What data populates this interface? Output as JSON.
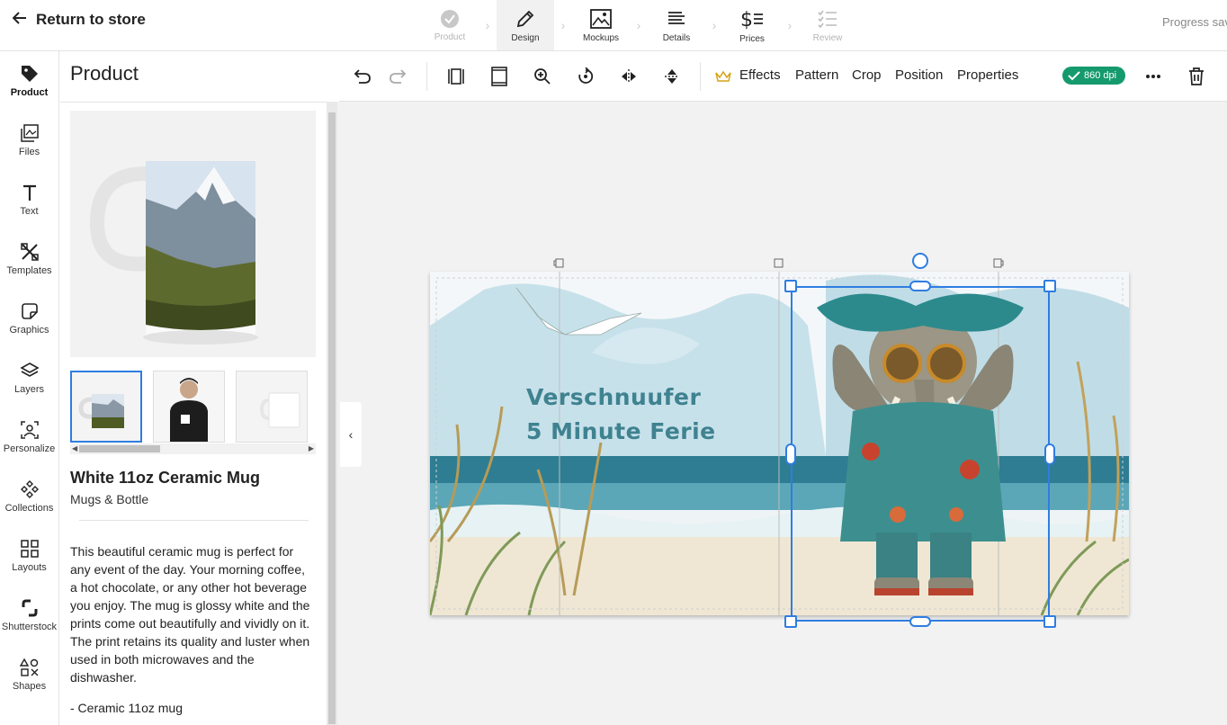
{
  "header": {
    "back_label": "Return to store",
    "steps": [
      {
        "label": "Product",
        "icon": "check-circle-icon",
        "state": "done"
      },
      {
        "label": "Design",
        "icon": "pencil-icon",
        "state": "active"
      },
      {
        "label": "Mockups",
        "icon": "image-icon",
        "state": "normal"
      },
      {
        "label": "Details",
        "icon": "text-lines-icon",
        "state": "normal"
      },
      {
        "label": "Prices",
        "icon": "dollar-icon",
        "state": "normal"
      },
      {
        "label": "Review",
        "icon": "checklist-icon",
        "state": "disabled"
      }
    ],
    "progress_text": "Progress saved"
  },
  "leftnav": {
    "items": [
      {
        "label": "Product",
        "icon": "tag-icon",
        "active": true
      },
      {
        "label": "Files",
        "icon": "files-icon"
      },
      {
        "label": "Text",
        "icon": "text-icon"
      },
      {
        "label": "Templates",
        "icon": "templates-icon"
      },
      {
        "label": "Graphics",
        "icon": "graphics-icon"
      },
      {
        "label": "Layers",
        "icon": "layers-icon"
      },
      {
        "label": "Personalize",
        "icon": "personalize-icon"
      },
      {
        "label": "Collections",
        "icon": "collections-icon"
      },
      {
        "label": "Layouts",
        "icon": "layouts-icon"
      },
      {
        "label": "Shutterstock",
        "icon": "shutterstock-icon"
      },
      {
        "label": "Shapes",
        "icon": "shapes-icon"
      }
    ]
  },
  "panel": {
    "title": "Product",
    "product_name": "White 11oz Ceramic Mug",
    "category": "Mugs & Bottle",
    "description": "This beautiful ceramic mug is perfect for any event of the day. Your morning coffee, a hot chocolate, or any other hot beverage you enjoy. The mug is glossy white and the prints come out beautifully and vividly on it. The print retains its quality and luster when used in both microwaves and the dishwasher.",
    "bullet": "- Ceramic 11oz mug"
  },
  "toolbar": {
    "effects": "Effects",
    "pattern": "Pattern",
    "crop": "Crop",
    "position": "Position",
    "properties": "Properties",
    "dpi": "860 dpi"
  },
  "design": {
    "headline_line1": "Verschnuufer",
    "headline_line2": "5 Minute Ferie",
    "headline_color": "#3f8290",
    "accent": "#2f7de1"
  }
}
